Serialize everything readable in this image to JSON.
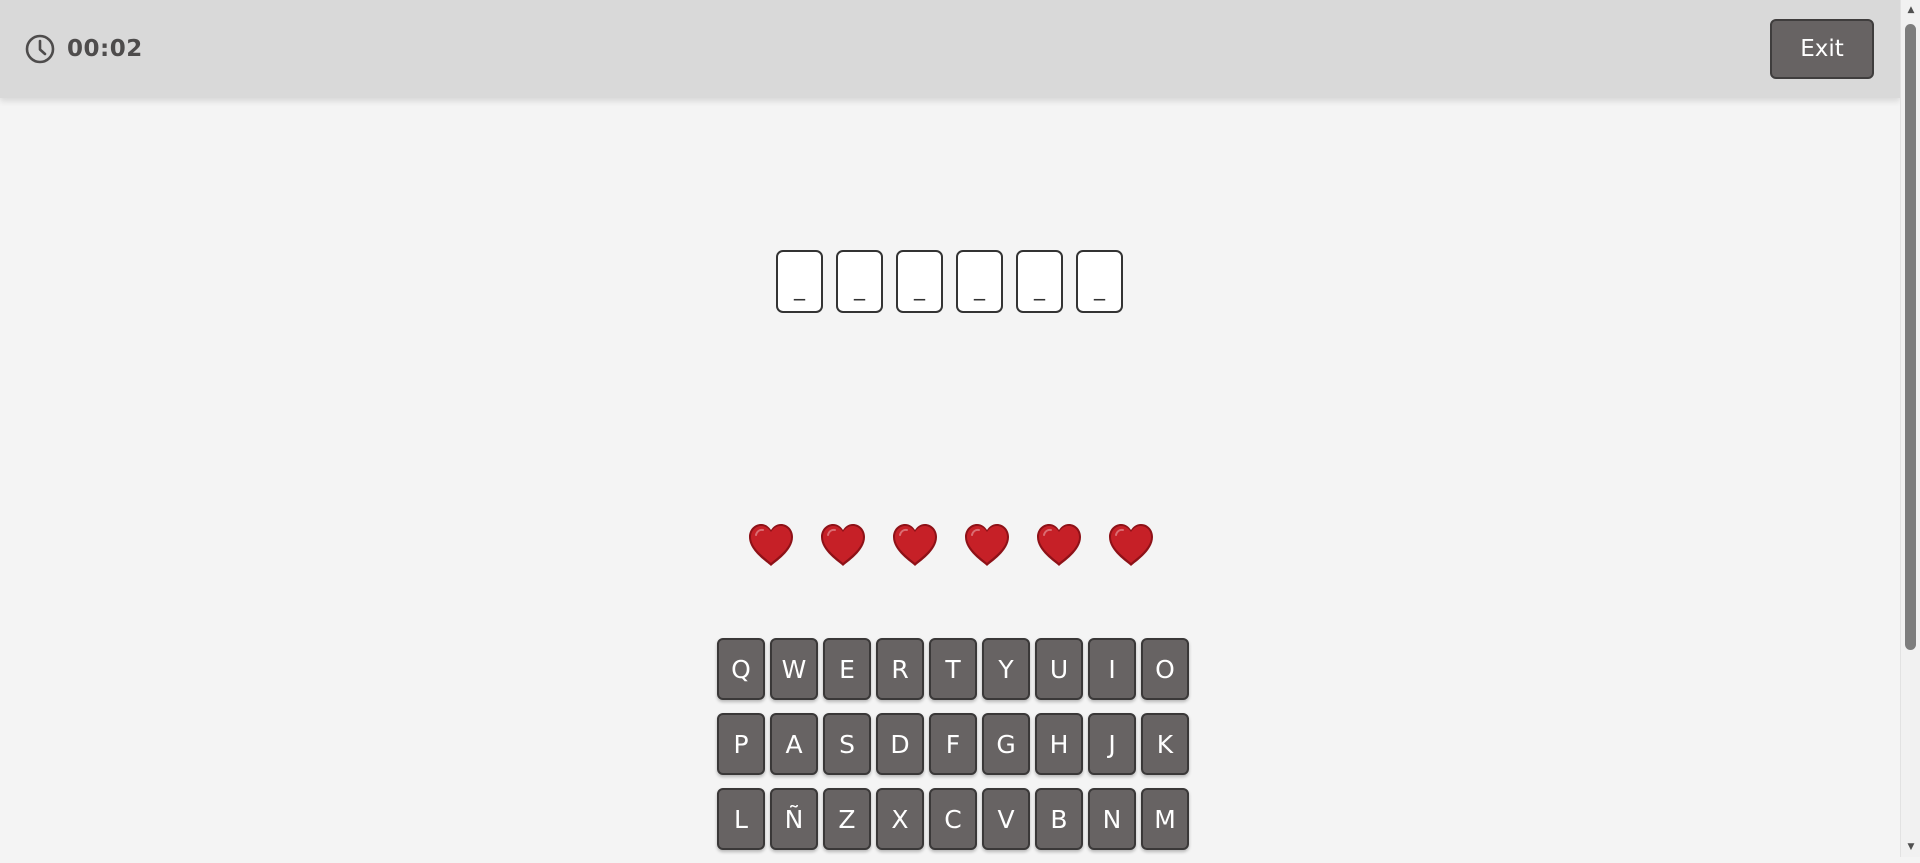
{
  "header": {
    "timer": "00:02",
    "exit_label": "Exit"
  },
  "word": {
    "slots": [
      "_",
      "_",
      "_",
      "_",
      "_",
      "_"
    ]
  },
  "lives": {
    "remaining": 6,
    "total": 6,
    "icon": "heart-icon",
    "color": "#c62027"
  },
  "keyboard": {
    "rows": [
      [
        "Q",
        "W",
        "E",
        "R",
        "T",
        "Y",
        "U",
        "I",
        "O"
      ],
      [
        "P",
        "A",
        "S",
        "D",
        "F",
        "G",
        "H",
        "J",
        "K"
      ],
      [
        "L",
        "Ñ",
        "Z",
        "X",
        "C",
        "V",
        "B",
        "N",
        "M"
      ]
    ]
  },
  "colors": {
    "header_bg": "#d9d9d9",
    "page_bg": "#f4f4f4",
    "key_bg": "#676363",
    "heart": "#c62027"
  }
}
